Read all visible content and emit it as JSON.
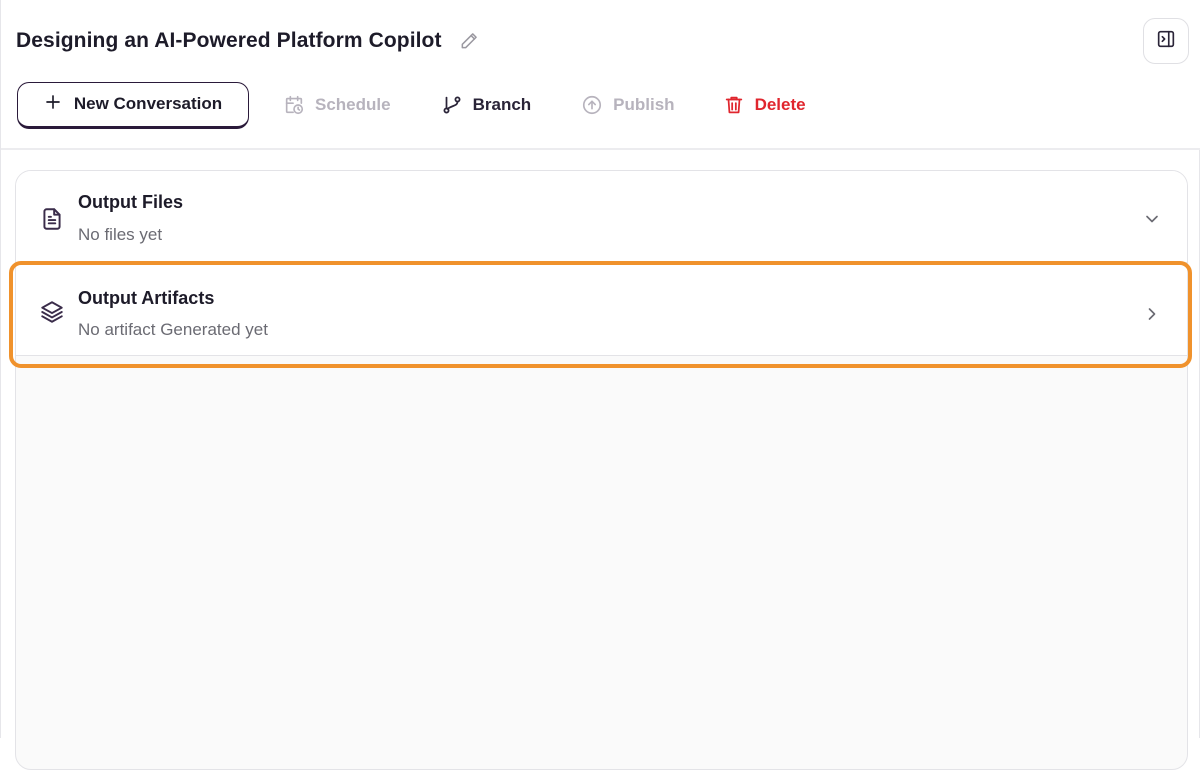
{
  "header": {
    "title": "Designing an AI-Powered Platform Copilot",
    "edit_icon": "pencil-icon",
    "panel_toggle_icon": "sidebar-collapse-icon"
  },
  "toolbar": {
    "new_conversation": {
      "label": "New Conversation",
      "icon": "plus-icon"
    },
    "schedule": {
      "label": "Schedule",
      "icon": "calendar-clock-icon",
      "state": "disabled"
    },
    "branch": {
      "label": "Branch",
      "icon": "git-branch-icon"
    },
    "publish": {
      "label": "Publish",
      "icon": "upload-circle-icon",
      "state": "disabled"
    },
    "delete": {
      "label": "Delete",
      "icon": "trash-icon"
    }
  },
  "sections": [
    {
      "title": "Output Files",
      "subtitle": "No files yet",
      "icon": "file-text-icon",
      "expanded": true
    },
    {
      "title": "Output Artifacts",
      "subtitle": "No artifact Generated yet",
      "icon": "layers-icon",
      "expanded": false,
      "highlighted": true
    }
  ],
  "colors": {
    "highlight": "#f0922c",
    "danger": "#e0262e",
    "disabled": "#b7b3bd",
    "primary_border": "#2a1a3a"
  }
}
